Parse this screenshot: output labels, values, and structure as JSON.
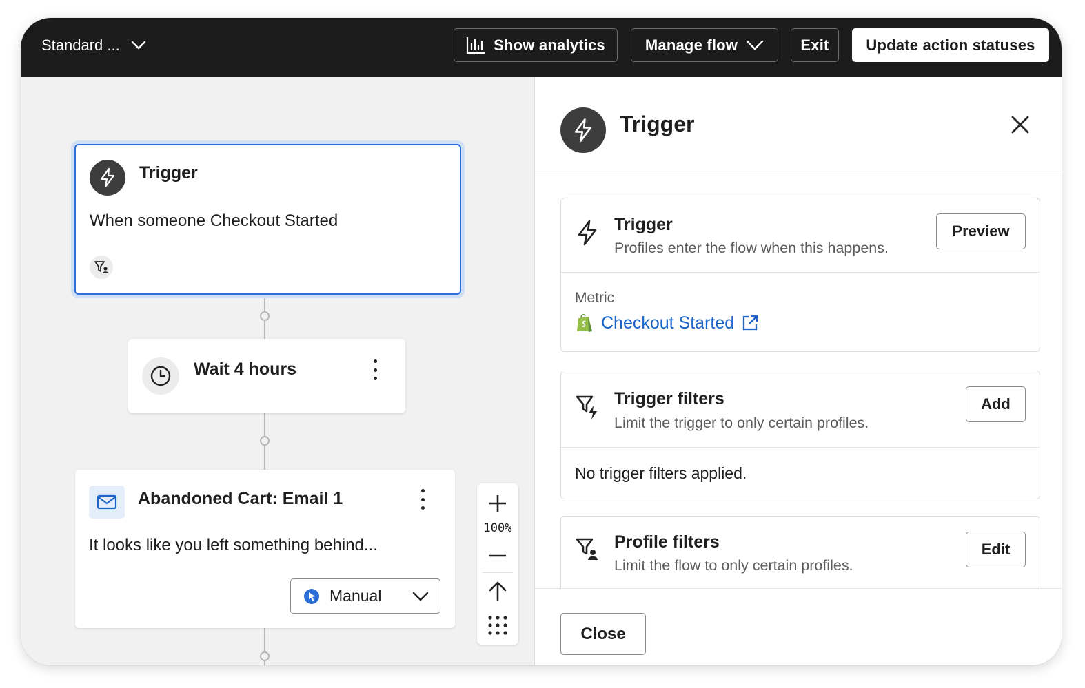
{
  "topbar": {
    "flow_name": "Standard ...",
    "show_analytics": "Show analytics",
    "manage_flow": "Manage flow",
    "exit": "Exit",
    "update_statuses": "Update action statuses"
  },
  "canvas": {
    "trigger_card": {
      "title": "Trigger",
      "description": "When someone Checkout Started"
    },
    "wait_card": {
      "title": "Wait 4 hours"
    },
    "email_card": {
      "title": "Abandoned Cart: Email 1",
      "preview": "It looks like you left something behind...",
      "status": "Manual"
    },
    "zoom": {
      "level": "100%"
    }
  },
  "panel": {
    "title": "Trigger",
    "trigger_section": {
      "title": "Trigger",
      "subtitle": "Profiles enter the flow when this happens.",
      "button": "Preview",
      "metric_label": "Metric",
      "metric_value": "Checkout Started"
    },
    "trigger_filters": {
      "title": "Trigger filters",
      "subtitle": "Limit the trigger to only certain profiles.",
      "button": "Add",
      "empty": "No trigger filters applied."
    },
    "profile_filters": {
      "title": "Profile filters",
      "subtitle": "Limit the flow to only certain profiles.",
      "button": "Edit"
    },
    "close": "Close"
  },
  "colors": {
    "selected_border": "#2d6fd6",
    "link": "#1b64c9",
    "shopify_green": "#95bf47",
    "topbar": "#1c1c1c"
  }
}
